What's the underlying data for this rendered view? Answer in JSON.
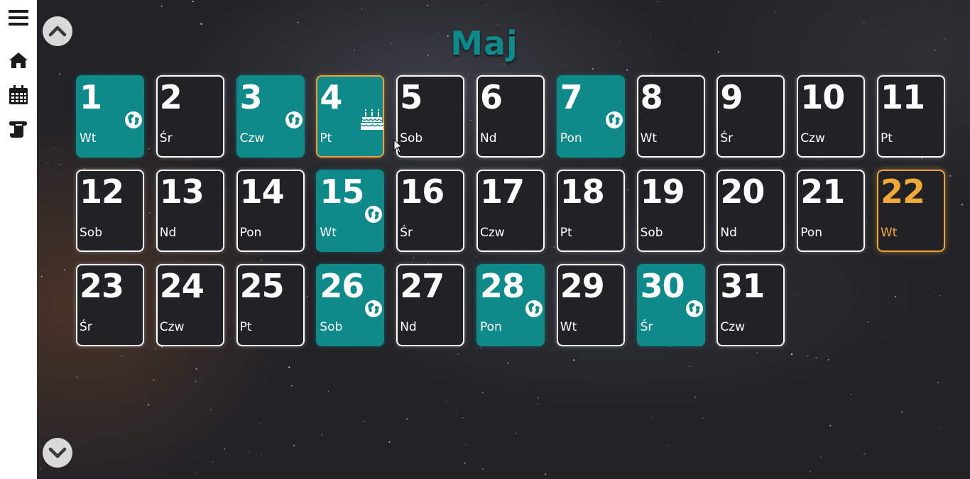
{
  "month": {
    "title": "Maj"
  },
  "colors": {
    "event": "#0f8a8b",
    "today": "#e8a33a",
    "border": "#ffffff",
    "title": "#0e8a8b"
  },
  "sidebar": {
    "items": [
      {
        "icon": "menu-icon"
      },
      {
        "icon": "home-icon"
      },
      {
        "icon": "calendar-icon"
      },
      {
        "icon": "scroll-icon"
      }
    ]
  },
  "nav": {
    "up": "chevron-up-icon",
    "down": "chevron-down-icon"
  },
  "days": [
    {
      "num": "1",
      "name": "Wt",
      "type": "event",
      "icon": "globe-icon"
    },
    {
      "num": "2",
      "name": "Śr",
      "type": "normal"
    },
    {
      "num": "3",
      "name": "Czw",
      "type": "event",
      "icon": "globe-icon"
    },
    {
      "num": "4",
      "name": "Pt",
      "type": "event-outline",
      "icon": "cake-icon"
    },
    {
      "num": "5",
      "name": "Sob",
      "type": "normal"
    },
    {
      "num": "6",
      "name": "Nd",
      "type": "normal"
    },
    {
      "num": "7",
      "name": "Pon",
      "type": "event",
      "icon": "globe-icon"
    },
    {
      "num": "8",
      "name": "Wt",
      "type": "normal"
    },
    {
      "num": "9",
      "name": "Śr",
      "type": "normal"
    },
    {
      "num": "10",
      "name": "Czw",
      "type": "normal"
    },
    {
      "num": "11",
      "name": "Pt",
      "type": "normal"
    },
    {
      "num": "12",
      "name": "Sob",
      "type": "normal"
    },
    {
      "num": "13",
      "name": "Nd",
      "type": "normal"
    },
    {
      "num": "14",
      "name": "Pon",
      "type": "normal"
    },
    {
      "num": "15",
      "name": "Wt",
      "type": "event",
      "icon": "globe-icon"
    },
    {
      "num": "16",
      "name": "Śr",
      "type": "normal"
    },
    {
      "num": "17",
      "name": "Czw",
      "type": "normal"
    },
    {
      "num": "18",
      "name": "Pt",
      "type": "normal"
    },
    {
      "num": "19",
      "name": "Sob",
      "type": "normal"
    },
    {
      "num": "20",
      "name": "Nd",
      "type": "normal"
    },
    {
      "num": "21",
      "name": "Pon",
      "type": "normal"
    },
    {
      "num": "22",
      "name": "Wt",
      "type": "today"
    },
    {
      "num": "23",
      "name": "Śr",
      "type": "normal"
    },
    {
      "num": "24",
      "name": "Czw",
      "type": "normal"
    },
    {
      "num": "25",
      "name": "Pt",
      "type": "normal"
    },
    {
      "num": "26",
      "name": "Sob",
      "type": "event",
      "icon": "globe-icon"
    },
    {
      "num": "27",
      "name": "Nd",
      "type": "normal"
    },
    {
      "num": "28",
      "name": "Pon",
      "type": "event",
      "icon": "globe-icon"
    },
    {
      "num": "29",
      "name": "Wt",
      "type": "normal"
    },
    {
      "num": "30",
      "name": "Śr",
      "type": "event",
      "icon": "globe-icon"
    },
    {
      "num": "31",
      "name": "Czw",
      "type": "normal"
    }
  ]
}
